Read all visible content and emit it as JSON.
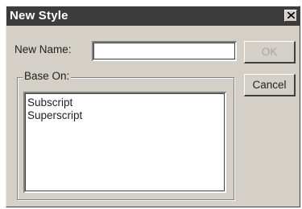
{
  "window": {
    "title": "New Style"
  },
  "form": {
    "name_label": "New Name:",
    "name_value": "",
    "base_group_label": "Base On:",
    "base_options": [
      "Subscript",
      "Superscript"
    ]
  },
  "buttons": {
    "ok": "OK",
    "cancel": "Cancel"
  },
  "icons": {
    "close": "close-icon"
  }
}
